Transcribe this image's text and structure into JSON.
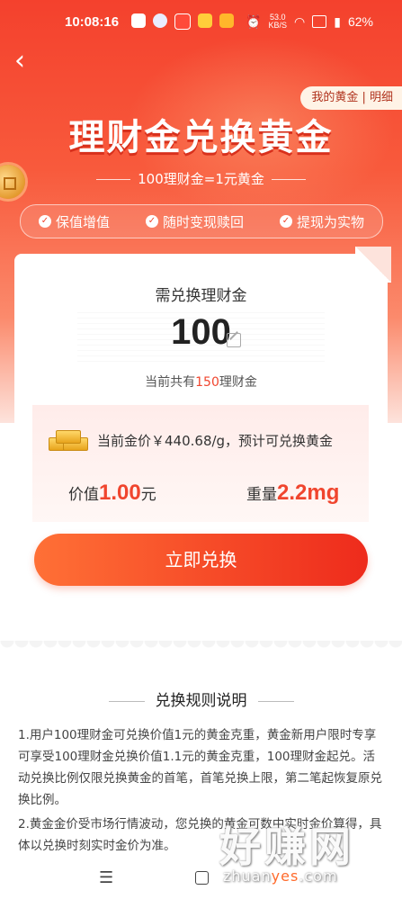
{
  "status_bar": {
    "time": "10:08:16",
    "net_speed": "53.0\nKB/S",
    "battery": "62%"
  },
  "header": {
    "my_gold_link": "我的黄金 | 明细",
    "title": "理财金兑换黄金",
    "subtitle": "100理财金=1元黄金",
    "features": [
      "保值增值",
      "随时变现赎回",
      "提现为实物"
    ]
  },
  "exchange": {
    "need_label": "需兑换理财金",
    "amount": "100",
    "balance_prefix": "当前共有",
    "balance_value": "150",
    "balance_suffix": "理财金",
    "gold_price_text": "当前金价￥440.68/g，预计可兑换黄金",
    "value_label": "价值",
    "value_num": "1.00",
    "value_unit": "元",
    "weight_label": "重量",
    "weight_num": "2.2mg",
    "button_label": "立即兑换"
  },
  "rules": {
    "title": "兑换规则说明",
    "rule1": "1.用户100理财金可兑换价值1元的黄金克重，黄金新用户限时专享可享受100理财金兑换价值1.1元的黄金克重，100理财金起兑。活动兑换比例仅限兑换黄金的首笔，首笔兑换上限，第二笔起恢复原兑换比例。",
    "rule2": "2.黄金金价受市场行情波动，您兑换的黄金可数中实时金价算得，具体以兑换时刻实时金价为准。"
  },
  "watermark": {
    "text": "好赚网",
    "url_a": "zhuan",
    "url_b": "yes",
    "url_c": ".com"
  },
  "colors": {
    "brand_red": "#f0452e",
    "button_start": "#ff7036",
    "button_end": "#ee2b1c"
  }
}
